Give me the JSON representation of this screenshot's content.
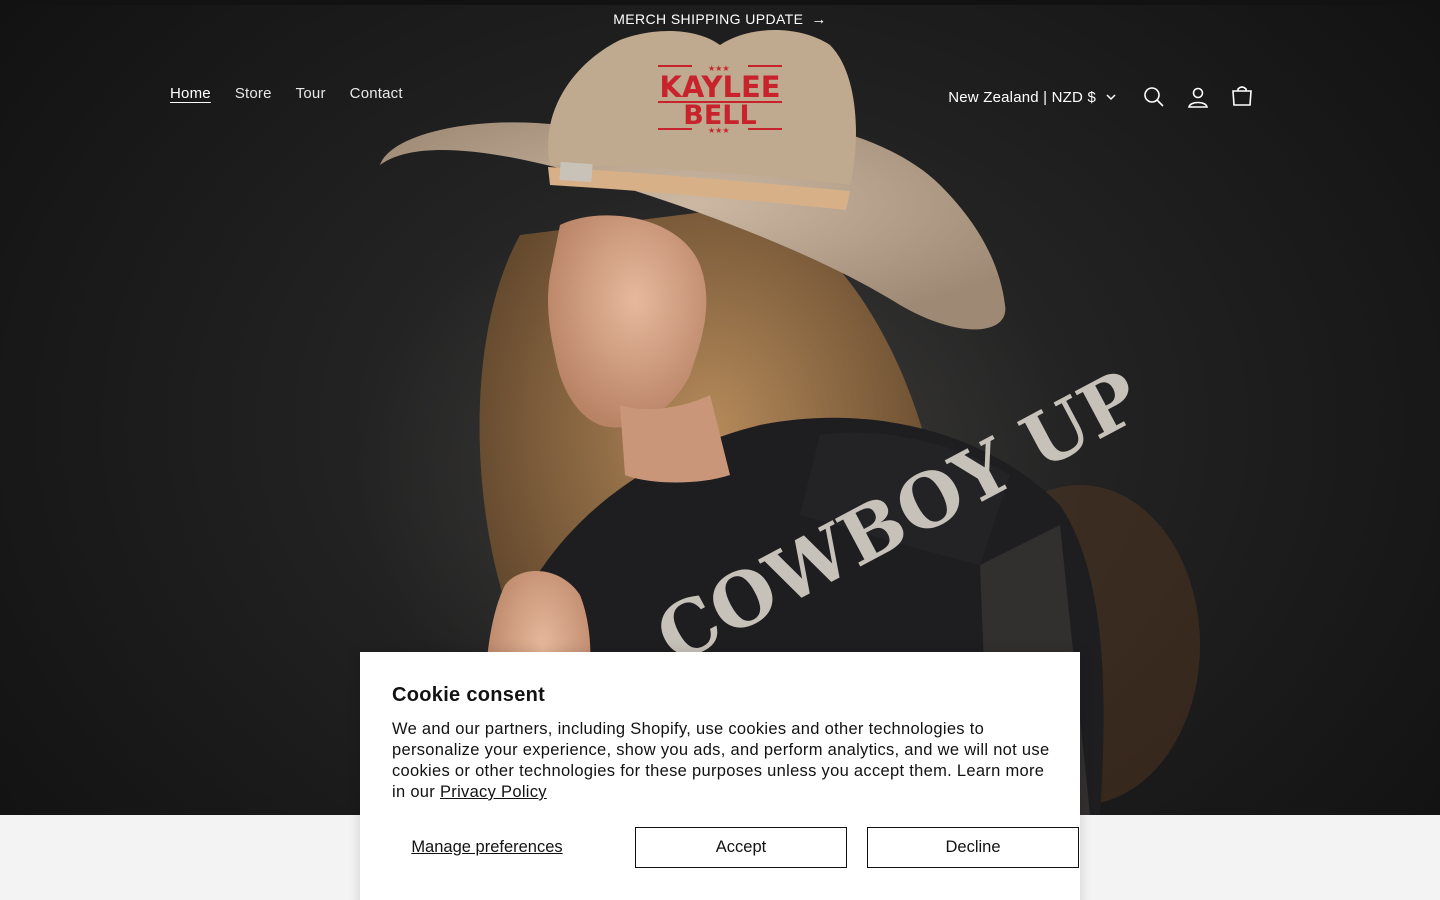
{
  "announcement": {
    "text": "MERCH SHIPPING UPDATE",
    "arrow": "→"
  },
  "nav": {
    "items": [
      {
        "label": "Home",
        "active": true
      },
      {
        "label": "Store",
        "active": false
      },
      {
        "label": "Tour",
        "active": false
      },
      {
        "label": "Contact",
        "active": false
      }
    ]
  },
  "logo": {
    "line1": "KAYLEE",
    "line2": "BELL",
    "color": "#c8232c"
  },
  "locale": {
    "label": "New Zealand | NZD $"
  },
  "icons": {
    "search": "search-icon",
    "account": "account-icon",
    "cart": "cart-icon",
    "chevron": "chevron-down-icon"
  },
  "hero": {
    "jacket_text": "COWBOY UP"
  },
  "cookie": {
    "title": "Cookie consent",
    "body": "We and our partners, including Shopify, use cookies and other technologies to personalize your experience, show you ads, and perform analytics, and we will not use cookies or other technologies for these purposes unless you accept them. Learn more in our ",
    "policy_link": "Privacy Policy",
    "manage_label": "Manage preferences",
    "accept_label": "Accept",
    "decline_label": "Decline"
  }
}
